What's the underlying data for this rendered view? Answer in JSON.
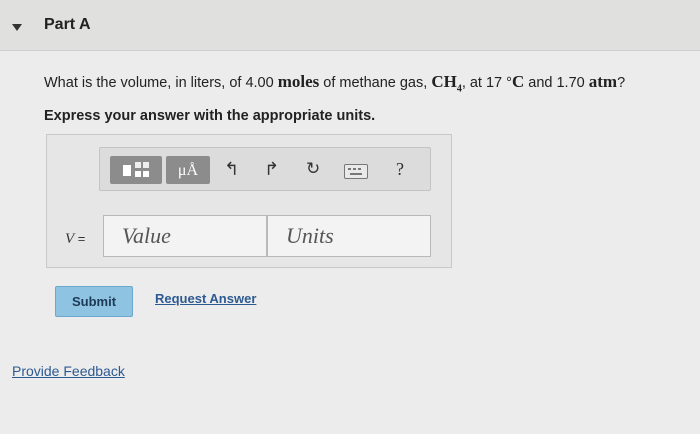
{
  "part": {
    "title": "Part A"
  },
  "question": {
    "text_1": "What is the volume, in liters, of 4.00 ",
    "unit_moles": "moles",
    "text_2": " of methane gas, ",
    "formula_ch": "CH",
    "formula_sub": "4",
    "text_3": ", at 17 °",
    "unit_c": "C",
    "text_4": " and 1.70 ",
    "unit_atm": "atm",
    "text_5": "?"
  },
  "instruction": "Express your answer with the appropriate units.",
  "toolbar": {
    "mu_label": "μÅ",
    "undo_glyph": "↰",
    "redo_glyph": "↱",
    "reset_glyph": "↻",
    "help_label": "?"
  },
  "answer": {
    "variable": "V",
    "equals": " =",
    "value_placeholder": "Value",
    "units_placeholder": "Units"
  },
  "buttons": {
    "submit": "Submit",
    "request_answer": "Request Answer"
  },
  "footer": {
    "feedback": "Provide Feedback"
  }
}
